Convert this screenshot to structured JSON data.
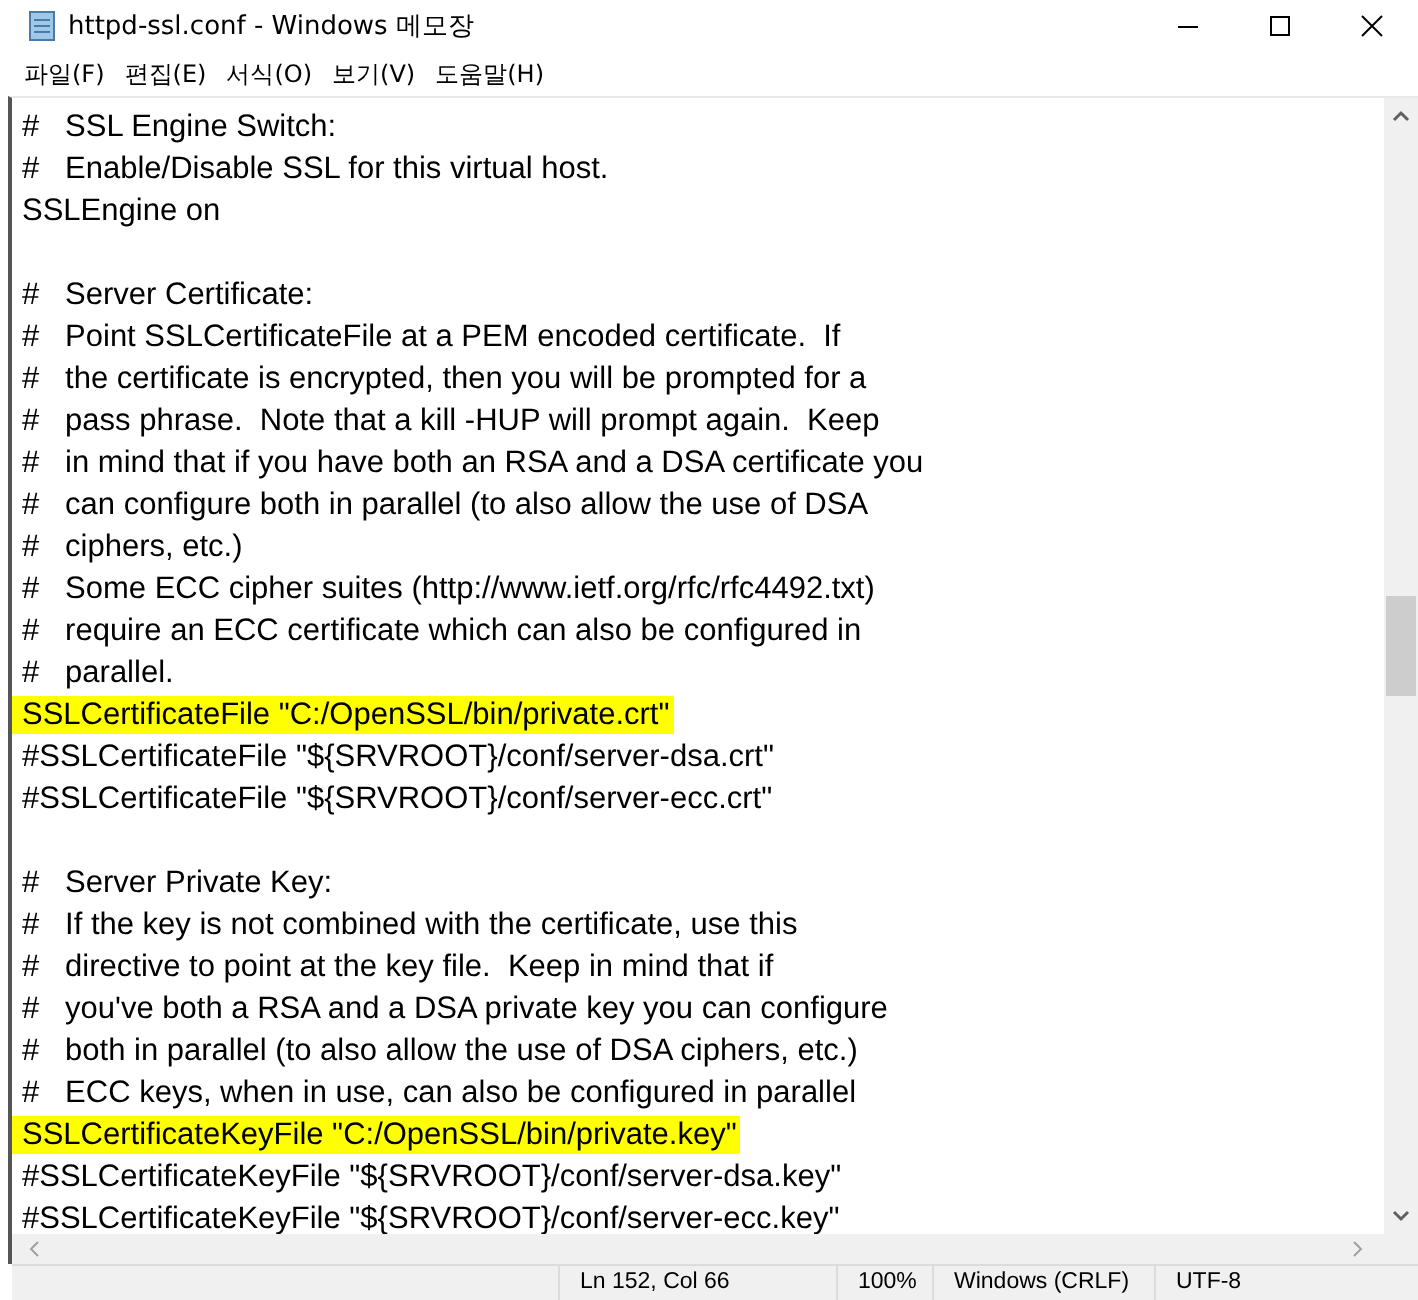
{
  "window": {
    "title": "httpd-ssl.conf - Windows 메모장"
  },
  "menu": [
    "파일(F)",
    "편집(E)",
    "서식(O)",
    "보기(V)",
    "도움말(H)"
  ],
  "editor": {
    "blocks": [
      {
        "lines": [
          {
            "text": "#   SSL Engine Switch:",
            "highlighted": false
          },
          {
            "text": "#   Enable/Disable SSL for this virtual host.",
            "highlighted": false
          },
          {
            "text": "SSLEngine on",
            "highlighted": false
          }
        ]
      },
      {
        "lines": [
          {
            "text": "#   Server Certificate:",
            "highlighted": false
          },
          {
            "text": "#   Point SSLCertificateFile at a PEM encoded certificate.  If",
            "highlighted": false
          },
          {
            "text": "#   the certificate is encrypted, then you will be prompted for a",
            "highlighted": false
          },
          {
            "text": "#   pass phrase.  Note that a kill -HUP will prompt again.  Keep",
            "highlighted": false
          },
          {
            "text": "#   in mind that if you have both an RSA and a DSA certificate you",
            "highlighted": false
          },
          {
            "text": "#   can configure both in parallel (to also allow the use of DSA",
            "highlighted": false
          },
          {
            "text": "#   ciphers, etc.)",
            "highlighted": false
          },
          {
            "text": "#   Some ECC cipher suites (http://www.ietf.org/rfc/rfc4492.txt)",
            "highlighted": false
          },
          {
            "text": "#   require an ECC certificate which can also be configured in",
            "highlighted": false
          },
          {
            "text": "#   parallel.",
            "highlighted": false
          },
          {
            "text": "SSLCertificateFile \"C:/OpenSSL/bin/private.crt\"",
            "highlighted": true
          },
          {
            "text": "#SSLCertificateFile \"${SRVROOT}/conf/server-dsa.crt\"",
            "highlighted": false
          },
          {
            "text": "#SSLCertificateFile \"${SRVROOT}/conf/server-ecc.crt\"",
            "highlighted": false
          }
        ]
      },
      {
        "lines": [
          {
            "text": "#   Server Private Key:",
            "highlighted": false
          },
          {
            "text": "#   If the key is not combined with the certificate, use this",
            "highlighted": false
          },
          {
            "text": "#   directive to point at the key file.  Keep in mind that if",
            "highlighted": false
          },
          {
            "text": "#   you've both a RSA and a DSA private key you can configure",
            "highlighted": false
          },
          {
            "text": "#   both in parallel (to also allow the use of DSA ciphers, etc.)",
            "highlighted": false
          },
          {
            "text": "#   ECC keys, when in use, can also be configured in parallel",
            "highlighted": false
          },
          {
            "text": "SSLCertificateKeyFile \"C:/OpenSSL/bin/private.key\"",
            "highlighted": true
          },
          {
            "text": "#SSLCertificateKeyFile \"${SRVROOT}/conf/server-dsa.key\"",
            "highlighted": false
          },
          {
            "text": "#SSLCertificateKeyFile \"${SRVROOT}/conf/server-ecc.key\"",
            "highlighted": false
          }
        ]
      }
    ]
  },
  "status_bar": [
    "Ln 152, Col 66",
    "100%",
    "Windows (CRLF)",
    "UTF-8"
  ]
}
